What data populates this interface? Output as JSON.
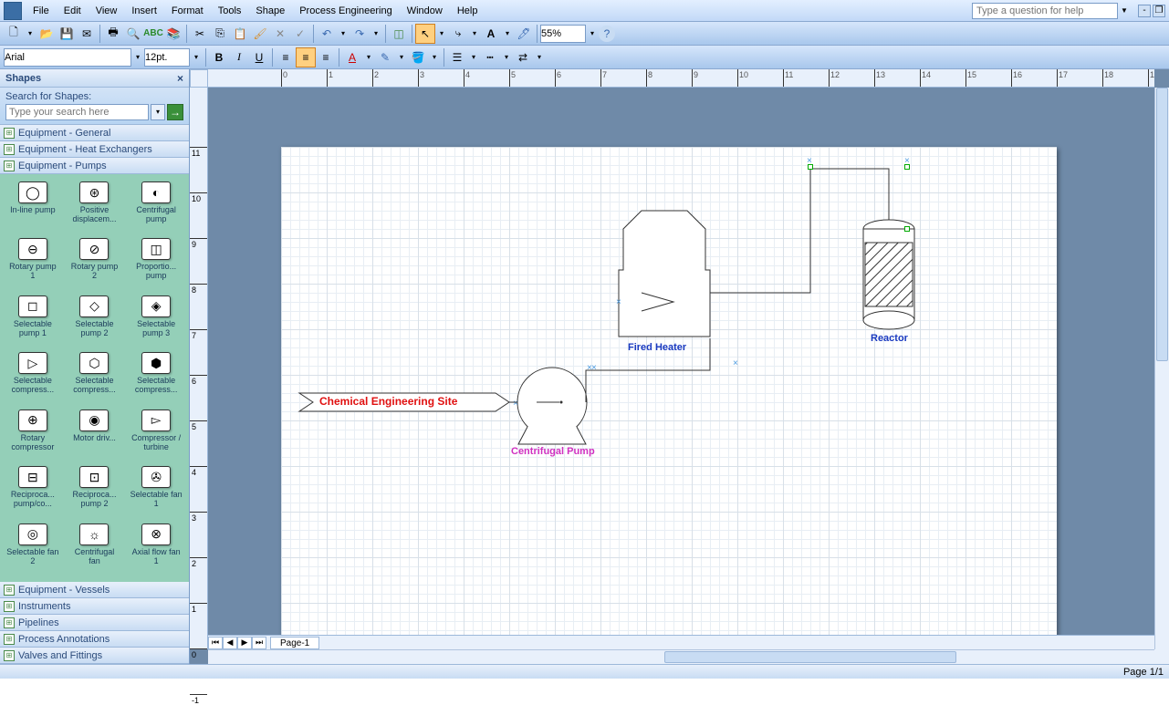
{
  "menubar": {
    "items": [
      "File",
      "Edit",
      "View",
      "Insert",
      "Format",
      "Tools",
      "Shape",
      "Process Engineering",
      "Window",
      "Help"
    ],
    "help_placeholder": "Type a question for help"
  },
  "toolbar1": {
    "zoom_value": "55%"
  },
  "toolbar2": {
    "font": "Arial",
    "size": "12pt."
  },
  "shapes_panel": {
    "title": "Shapes",
    "search_label": "Search for Shapes:",
    "search_placeholder": "Type your search here",
    "stencils_before": [
      "Equipment - General",
      "Equipment - Heat Exchangers",
      "Equipment - Pumps"
    ],
    "shapes": [
      {
        "label": "In-line pump"
      },
      {
        "label": "Positive displacem..."
      },
      {
        "label": "Centrifugal pump"
      },
      {
        "label": "Rotary pump 1"
      },
      {
        "label": "Rotary pump 2"
      },
      {
        "label": "Proportio... pump"
      },
      {
        "label": "Selectable pump 1"
      },
      {
        "label": "Selectable pump 2"
      },
      {
        "label": "Selectable pump 3"
      },
      {
        "label": "Selectable compress..."
      },
      {
        "label": "Selectable compress..."
      },
      {
        "label": "Selectable compress..."
      },
      {
        "label": "Rotary compressor"
      },
      {
        "label": "Motor driv..."
      },
      {
        "label": "Compressor / turbine"
      },
      {
        "label": "Reciproca... pump/co..."
      },
      {
        "label": "Reciproca... pump 2"
      },
      {
        "label": "Selectable fan 1"
      },
      {
        "label": "Selectable fan 2"
      },
      {
        "label": "Centrifugal fan"
      },
      {
        "label": "Axial flow fan 1"
      }
    ],
    "stencils_after": [
      "Equipment - Vessels",
      "Instruments",
      "Pipelines",
      "Process Annotations",
      "Valves and Fittings"
    ]
  },
  "canvas": {
    "page_tab": "Page-1",
    "label_text": "Chemical Engineering Site",
    "heater_label": "Fired Heater",
    "pump_label": "Centrifugal Pump",
    "reactor_label": "Reactor"
  },
  "statusbar": {
    "page": "Page 1/1"
  }
}
